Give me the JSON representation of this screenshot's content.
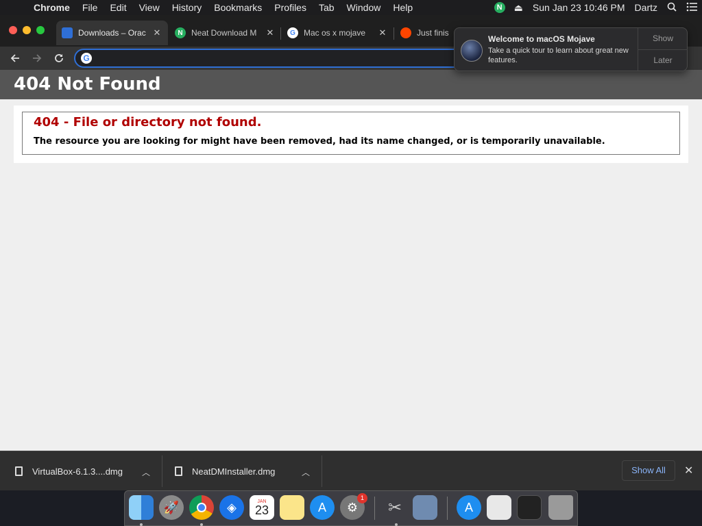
{
  "menubar": {
    "app_name": "Chrome",
    "menus": [
      "File",
      "Edit",
      "View",
      "History",
      "Bookmarks",
      "Profiles",
      "Tab",
      "Window",
      "Help"
    ],
    "clock": "Sun Jan 23  10:46 PM",
    "user": "Dartz",
    "neat_letter": "N"
  },
  "tabs": [
    {
      "title": "Downloads – Orac",
      "favicon_color": "#2f6fd6"
    },
    {
      "title": "Neat Download M",
      "favicon_color": "#27ae60",
      "favicon_letter": "N"
    },
    {
      "title": "Mac os x mojave",
      "favicon_color": "#ffffff",
      "favicon_letter": "G"
    },
    {
      "title": "Just finis",
      "favicon_color": "#ff4500"
    }
  ],
  "omnibox": {
    "value": "",
    "engine_letter": "G"
  },
  "page": {
    "header": "404 Not Found",
    "error_title": "404 - File or directory not found.",
    "error_description": "The resource you are looking for might have been removed, had its name changed, or is temporarily unavailable."
  },
  "notification": {
    "title": "Welcome to macOS Mojave",
    "body": "Take a quick tour to learn about great new features.",
    "show_label": "Show",
    "later_label": "Later"
  },
  "downloads": {
    "items": [
      {
        "filename": "VirtualBox-6.1.3....dmg"
      },
      {
        "filename": "NeatDMInstaller.dmg"
      }
    ],
    "show_all_label": "Show All"
  },
  "dock": {
    "calendar_month": "JAN",
    "calendar_day": "23",
    "prefs_badge": "1"
  },
  "colors": {
    "error_red": "#b00000",
    "header_gray": "#555555",
    "link_blue": "#8ab4f8"
  }
}
